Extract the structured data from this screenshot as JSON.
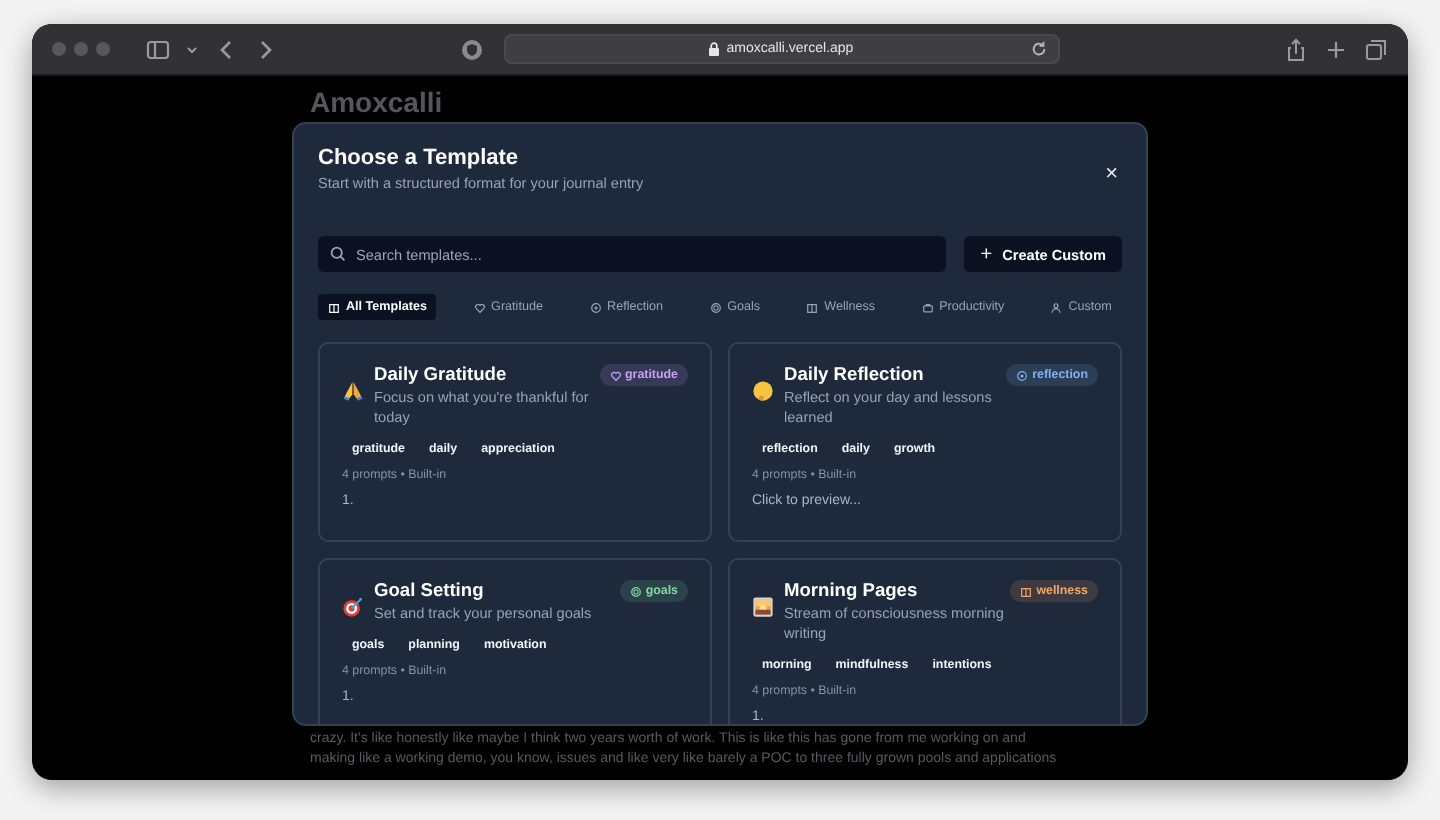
{
  "browser": {
    "url": "amoxcalli.vercel.app"
  },
  "page": {
    "title": "Amoxcalli",
    "paragraph": [
      "crazy. It's like honestly like maybe I think two years worth of work. This is like this has gone from me working on and",
      "making like a working demo, you know, issues and like very like barely a POC to three fully grown pools and applications"
    ]
  },
  "dialog": {
    "title": "Choose a Template",
    "subtitle": "Start with a structured format for your journal entry",
    "close": "×",
    "search": {
      "placeholder": "Search templates..."
    },
    "create_button": {
      "icon": "+",
      "label": "Create Custom"
    },
    "tabs": [
      {
        "label": "All Templates",
        "selected": true
      },
      {
        "label": "Gratitude",
        "selected": false
      },
      {
        "label": "Reflection",
        "selected": false
      },
      {
        "label": "Goals",
        "selected": false
      },
      {
        "label": "Wellness",
        "selected": false
      },
      {
        "label": "Productivity",
        "selected": false
      },
      {
        "label": "Custom",
        "selected": false
      }
    ],
    "templates": [
      {
        "title": "Daily Gratitude",
        "description": "Focus on what you're thankful for today",
        "category": "gratitude",
        "color": "#c4a1f5",
        "tags": [
          "gratitude",
          "daily",
          "appreciation"
        ],
        "meta": "4 prompts • Built-in",
        "preview": "1."
      },
      {
        "title": "Daily Reflection",
        "description": "Reflect on your day and lessons learned",
        "category": "reflection",
        "color": "#7fb2f0",
        "tags": [
          "reflection",
          "daily",
          "growth"
        ],
        "meta": "4 prompts • Built-in",
        "preview": "Click to preview..."
      },
      {
        "title": "Goal Setting",
        "description": "Set and track your personal goals",
        "category": "goals",
        "color": "#7ed9a0",
        "tags": [
          "goals",
          "planning",
          "motivation"
        ],
        "meta": "4 prompts • Built-in",
        "preview": "1."
      },
      {
        "title": "Morning Pages",
        "description": "Stream of consciousness morning writing",
        "category": "wellness",
        "color": "#f0a868",
        "tags": [
          "morning",
          "mindfulness",
          "intentions"
        ],
        "meta": "4 prompts • Built-in",
        "preview": "1."
      }
    ]
  }
}
